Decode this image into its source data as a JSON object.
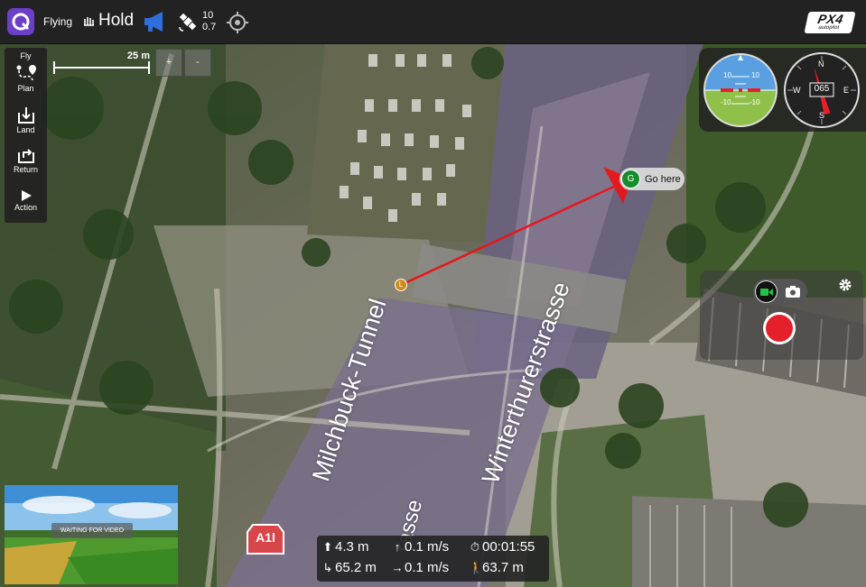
{
  "toolbar": {
    "flight_mode_label": "Flying",
    "mode": "Hold",
    "gps_satellites": "10",
    "gps_hdop": "0.7",
    "brand_main": "PX4",
    "brand_sub": "autopilot",
    "icons": [
      "app-logo-icon",
      "hold-mode-icon",
      "megaphone-icon",
      "satellite-icon",
      "target-icon"
    ]
  },
  "toolstrip": {
    "items": [
      {
        "label": "Fly",
        "icon": ""
      },
      {
        "label": "Plan",
        "icon": "plan-route-icon"
      },
      {
        "label": "Land",
        "icon": "land-icon"
      },
      {
        "label": "Return",
        "icon": "return-icon"
      },
      {
        "label": "Action",
        "icon": "play-icon"
      }
    ]
  },
  "map": {
    "scale_label": "25 m",
    "zoom_in": "+",
    "zoom_out": "-",
    "go_here": {
      "marker": "G",
      "label": "Go here"
    },
    "vehicle_marker": "L",
    "road_labels": [
      "Milchbuck-Tunnel",
      "Winterthurerstrasse",
      "rasse"
    ],
    "highway_shield": "A1l"
  },
  "instruments": {
    "attitude_marks": [
      "10",
      "10",
      "-10",
      "-10"
    ],
    "compass_heading": "065",
    "compass_points": [
      "N",
      "W",
      "E",
      "S"
    ]
  },
  "video": {
    "status": "WAITING FOR VIDEO"
  },
  "telemetry": {
    "altitude": "4.3 m",
    "vertical_speed": "0.1 m/s",
    "flight_time": "00:01:55",
    "distance_home": "65.2 m",
    "horizontal_speed": "0.1 m/s",
    "distance_gcs": "63.7 m"
  },
  "colors": {
    "toolbar_bg": "#222222",
    "accent_purple": "#6b3fc7",
    "record_red": "#e5202a",
    "goto_green": "#168c2c",
    "flight_path": "#e8161b",
    "mode_icon_blue": "#2f6fdc"
  }
}
